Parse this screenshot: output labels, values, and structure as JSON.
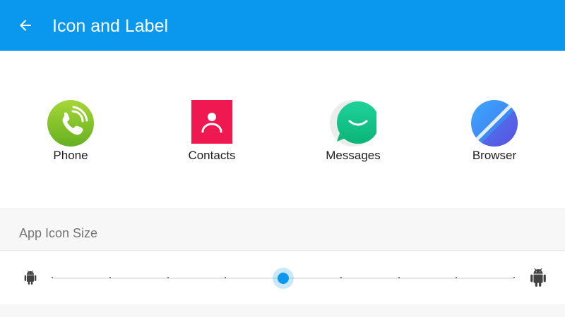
{
  "app_bar": {
    "title": "Icon and Label",
    "background": "#0a98ef",
    "back_icon": "arrow-left-icon"
  },
  "preview": {
    "apps": [
      {
        "label": "Phone",
        "icon": "phone-icon"
      },
      {
        "label": "Contacts",
        "icon": "contacts-icon"
      },
      {
        "label": "Messages",
        "icon": "messages-icon"
      },
      {
        "label": "Browser",
        "icon": "browser-icon"
      }
    ]
  },
  "settings": {
    "section_title": "App Icon Size",
    "slider": {
      "min_icon": "android-small-icon",
      "max_icon": "android-large-icon",
      "steps": 9,
      "selected_step": 4,
      "accent": "#0a98ef"
    }
  }
}
